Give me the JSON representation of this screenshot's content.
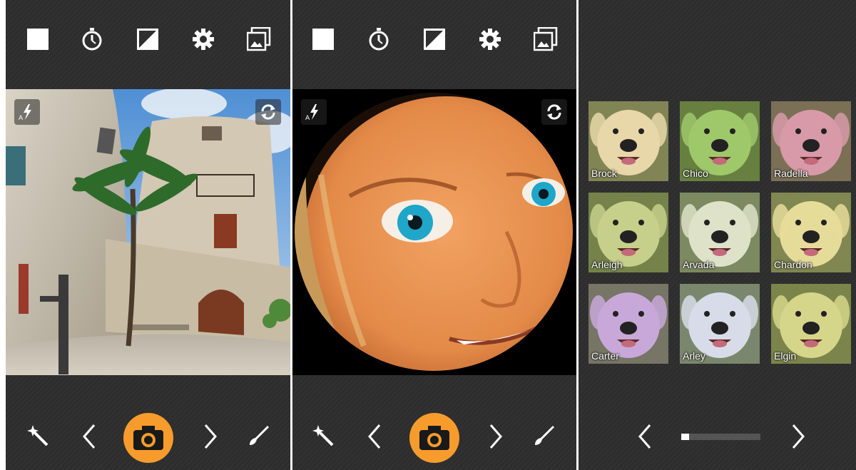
{
  "panels": [
    {
      "topbar": {
        "icons": [
          "square-icon",
          "timer-icon",
          "exposure-icon",
          "gear-icon",
          "gallery-icon"
        ]
      },
      "viewport": {
        "scene": "fisheye courtyard photo",
        "flash_icon": "auto-flash-icon",
        "switch_icon": "switch-camera-icon"
      },
      "bottombar": {
        "icons": [
          "magic-wand-icon",
          "chevron-left-icon",
          "camera-icon",
          "chevron-right-icon",
          "brush-icon"
        ]
      }
    },
    {
      "topbar": {
        "icons": [
          "square-icon",
          "timer-icon",
          "exposure-icon",
          "gear-icon",
          "gallery-icon"
        ]
      },
      "viewport": {
        "scene": "fisheye face photo",
        "flash_icon": "auto-flash-icon",
        "switch_icon": "switch-camera-icon"
      },
      "bottombar": {
        "icons": [
          "magic-wand-icon",
          "chevron-left-icon",
          "camera-icon",
          "chevron-right-icon",
          "brush-icon"
        ]
      }
    }
  ],
  "filters": {
    "items": [
      {
        "label": "Brock",
        "tint": "#e8d7a8"
      },
      {
        "label": "Chico",
        "tint": "#9fc86a"
      },
      {
        "label": "Radella",
        "tint": "#d89aa8"
      },
      {
        "label": "Arleigh",
        "tint": "#c6d08a"
      },
      {
        "label": "Arvada",
        "tint": "#dde2c8"
      },
      {
        "label": "Chardon",
        "tint": "#e6dc9a"
      },
      {
        "label": "Carter",
        "tint": "#c8a8d8"
      },
      {
        "label": "Arley",
        "tint": "#d8dce8"
      },
      {
        "label": "Elgin",
        "tint": "#d6d68a"
      }
    ],
    "pager": {
      "progress": 0.1
    }
  },
  "colors": {
    "shutter": "#f79c2c",
    "bar": "#2e2e2e"
  }
}
